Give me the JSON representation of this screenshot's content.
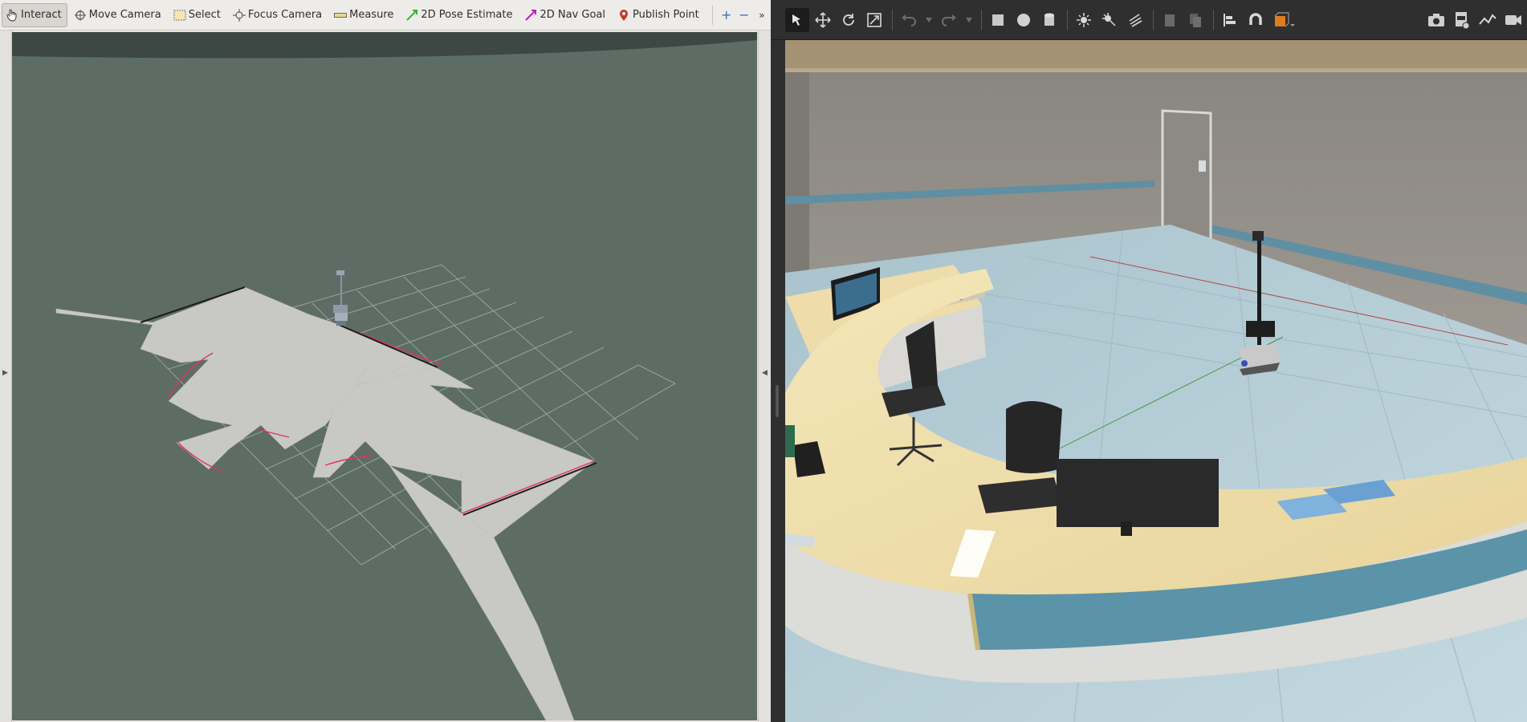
{
  "rviz": {
    "toolbar": {
      "tools": [
        {
          "label": "Interact",
          "icon": "hand-pointer-icon",
          "active": true
        },
        {
          "label": "Move Camera",
          "icon": "move-camera-icon",
          "active": false
        },
        {
          "label": "Select",
          "icon": "select-box-icon",
          "active": false
        },
        {
          "label": "Focus Camera",
          "icon": "focus-crosshair-icon",
          "active": false
        },
        {
          "label": "Measure",
          "icon": "ruler-icon",
          "active": false
        },
        {
          "label": "2D Pose Estimate",
          "icon": "green-arrow-icon",
          "active": false
        },
        {
          "label": "2D Nav Goal",
          "icon": "magenta-arrow-icon",
          "active": false
        },
        {
          "label": "Publish Point",
          "icon": "map-pin-icon",
          "active": false
        }
      ],
      "add_tool": "+",
      "remove_tool": "−",
      "overflow": "»"
    },
    "colors": {
      "background": "#5d6d66",
      "map_free": "#c8c8c4",
      "grid": "#b9c3bf",
      "laser": "#e0335a",
      "toolbar_bg": "#edece9"
    }
  },
  "gazebo": {
    "toolbar": {
      "tools": [
        "select-arrow-icon",
        "translate-icon",
        "rotate-icon",
        "scale-icon",
        "undo-icon",
        "redo-icon",
        "box-icon",
        "sphere-icon",
        "cylinder-icon",
        "point-light-icon",
        "spot-light-icon",
        "directional-light-icon",
        "copy-icon",
        "paste-icon",
        "align-icon",
        "snap-magnet-icon",
        "change-view-icon",
        "screenshot-camera-icon",
        "log-icon",
        "plot-icon",
        "video-record-icon"
      ]
    },
    "colors": {
      "wall": "#8f8b84",
      "floor": "#b8d0d8",
      "desk_top": "#eedcaa",
      "desk_panel": "#5b93a8",
      "desk_base": "#d7d7d3",
      "accent_orange": "#e07b1e"
    }
  }
}
